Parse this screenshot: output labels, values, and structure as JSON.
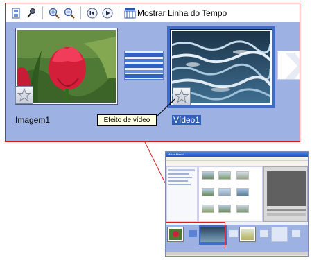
{
  "toolbar": {
    "timeline_label": "Mostrar Linha do Tempo"
  },
  "storyboard": {
    "clips": [
      {
        "label": "Imagem1"
      },
      {
        "label": "Vídeo1"
      }
    ]
  },
  "tooltip": {
    "text": "Efeito de vídeo"
  },
  "mini_window": {
    "title": "Movie Maker"
  },
  "icons": {
    "storyboard_toggle": "storyboard-icon",
    "narrate": "microphone-icon",
    "zoom_in": "zoom-in-icon",
    "zoom_out": "zoom-out-icon",
    "rewind": "rewind-icon",
    "play": "play-icon",
    "timeline": "timeline-icon",
    "effect": "star-effect-icon"
  },
  "colors": {
    "callout_border": "#d81e1e",
    "storyboard_bg": "#9db1e3",
    "selection": "#3e6cc6",
    "tooltip_bg": "#ffffe1"
  }
}
